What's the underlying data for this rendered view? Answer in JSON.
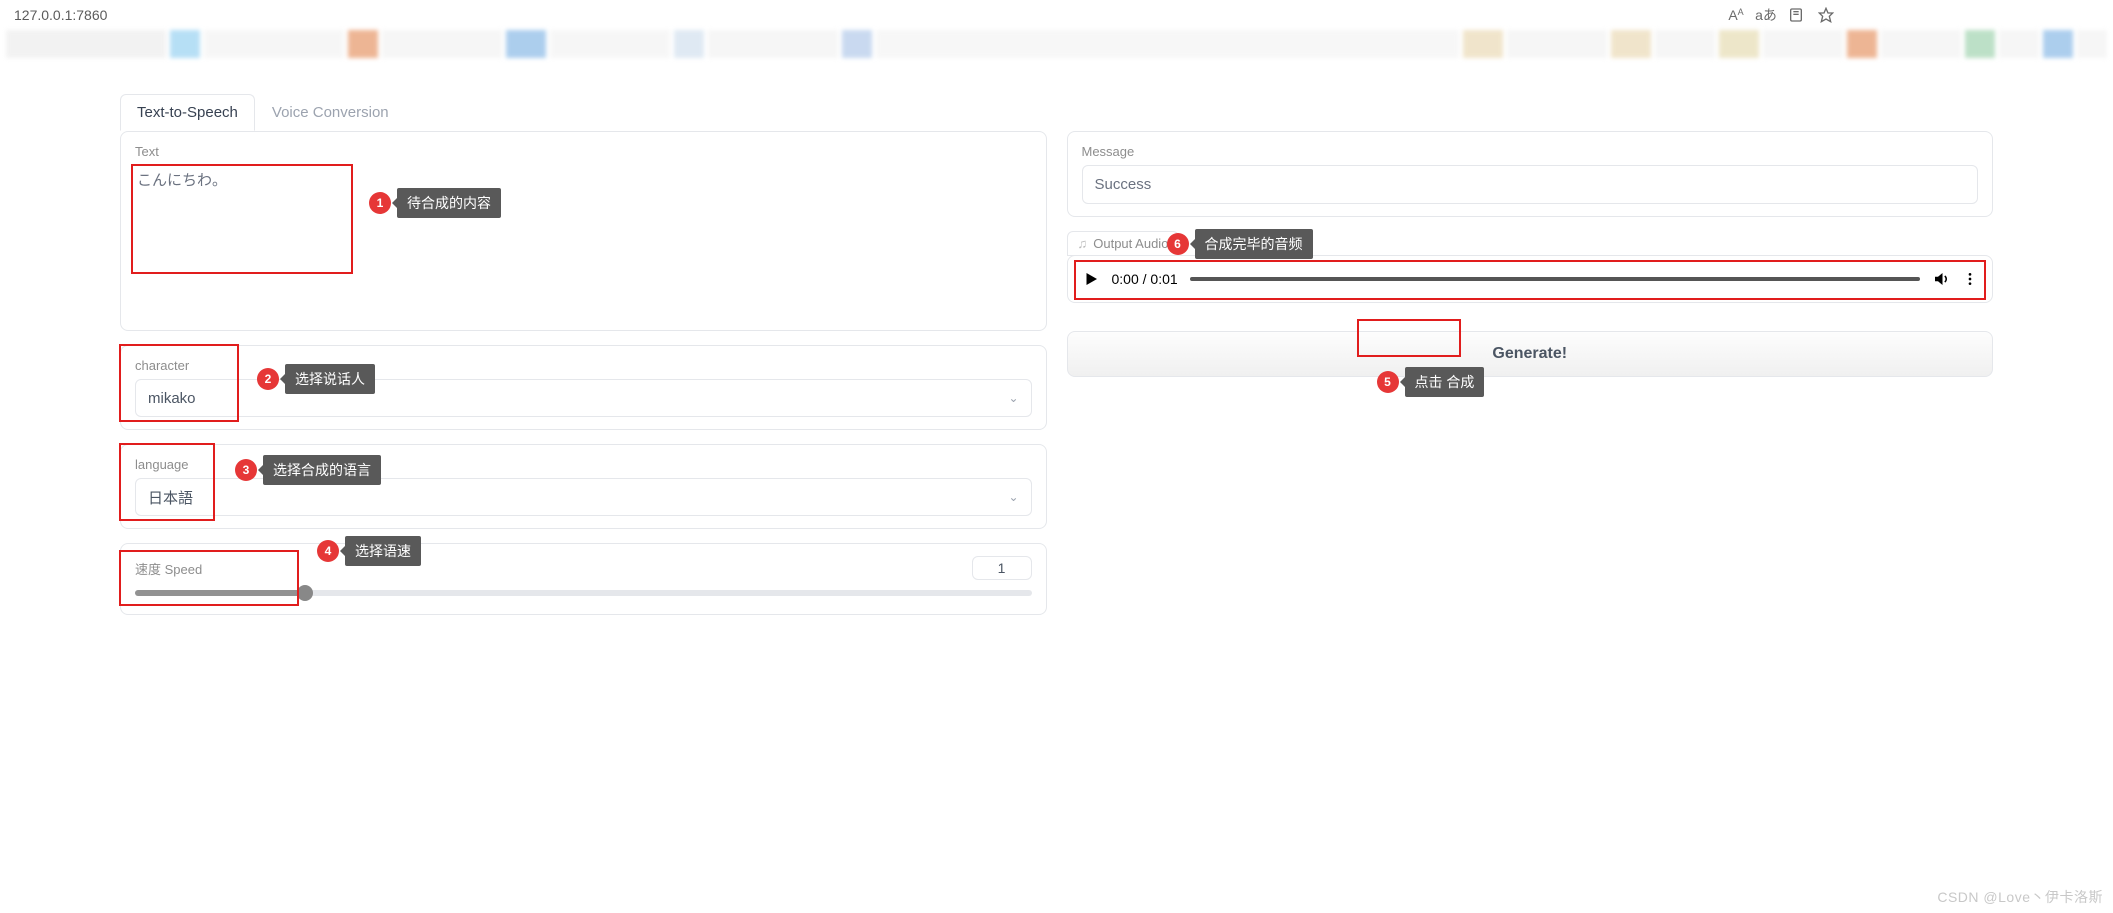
{
  "browser": {
    "url": "127.0.0.1:7860",
    "icons": [
      "text-size-icon",
      "translate-icon",
      "reader-icon",
      "favorite-icon"
    ]
  },
  "tabs": {
    "tts": "Text-to-Speech",
    "vc": "Voice Conversion"
  },
  "left": {
    "text_label": "Text",
    "text_value": "こんにちわ。",
    "character_label": "character",
    "character_value": "mikako",
    "language_label": "language",
    "language_value": "日本語",
    "speed_label": "速度 Speed",
    "speed_value": "1"
  },
  "right": {
    "message_label": "Message",
    "message_value": "Success",
    "output_audio_label": "Output Audio",
    "audio_time": "0:00 / 0:01",
    "generate_label": "Generate!"
  },
  "annotations": {
    "a1": "待合成的内容",
    "a2": "选择说话人",
    "a3": "选择合成的语言",
    "a4": "选择语速",
    "a5": "点击 合成",
    "a6": "合成完毕的音频"
  },
  "watermark": "CSDN @Love丶伊卡洛斯"
}
